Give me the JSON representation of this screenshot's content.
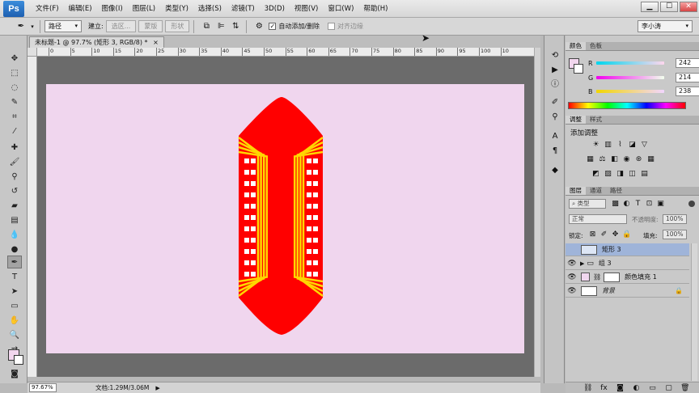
{
  "app": {
    "logo": "Ps",
    "menu": [
      "文件(F)",
      "编辑(E)",
      "图像(I)",
      "图层(L)",
      "类型(Y)",
      "选择(S)",
      "滤镜(T)",
      "3D(D)",
      "视图(V)",
      "窗口(W)",
      "帮助(H)"
    ],
    "window_controls": [
      "▁",
      "☐",
      "✕"
    ]
  },
  "options": {
    "mode_value": "路径",
    "make_label": "建立:",
    "selection_btn": "选区...",
    "mask_btn": "蒙版",
    "shape_btn": "形状",
    "auto_add_label": "自动添加/删除",
    "auto_add_checked": "✓",
    "align_edges_label": "对齐边缘",
    "workspace_value": "李小涛"
  },
  "document": {
    "tab_title": "未标题-1 @ 97.7% (矩形 3, RGB/8) *",
    "tab_close": "×",
    "canvas_color": "#f0d6ee",
    "ruler_ticks": [
      "0",
      "5",
      "10",
      "15",
      "20",
      "25",
      "30",
      "35",
      "40",
      "45",
      "50",
      "55",
      "60",
      "65",
      "70",
      "75",
      "80",
      "85",
      "90",
      "95",
      "100",
      "10"
    ],
    "zoom": "97.67%",
    "doc_info": "文档:1.29M/3.06M"
  },
  "color_panel": {
    "tabs": [
      "颜色",
      "色板"
    ],
    "r_label": "R",
    "r_value": "242",
    "g_label": "G",
    "g_value": "214",
    "b_label": "B",
    "b_value": "238",
    "fg_color": "#f2d6ee"
  },
  "adjust_panel": {
    "tabs": [
      "调整",
      "样式"
    ],
    "title": "添加调整"
  },
  "layers_panel": {
    "tabs": [
      "图层",
      "通道",
      "路径"
    ],
    "filter_kind": "类型",
    "blend_mode": "正常",
    "opacity_label": "不透明度:",
    "opacity_value": "100%",
    "lock_label": "锁定:",
    "fill_label": "填充:",
    "fill_value": "100%",
    "layers": [
      {
        "name": "矩形 3",
        "visible": false,
        "selected": true
      },
      {
        "name": "组 3",
        "visible": true,
        "selected": false
      },
      {
        "name": "颜色填充 1",
        "visible": true,
        "selected": false
      },
      {
        "name": "背景",
        "visible": true,
        "selected": false
      }
    ]
  },
  "artwork": {
    "main_color": "#ff0000",
    "stripe_color": "#ffd700",
    "window_color": "#ffffff"
  }
}
